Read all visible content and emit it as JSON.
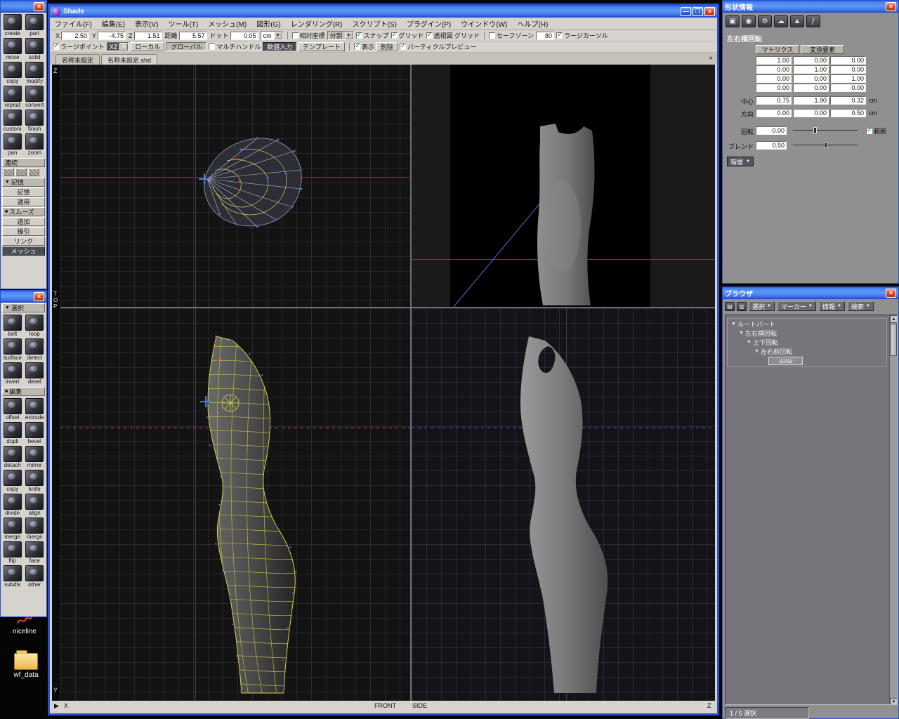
{
  "colors": {
    "titlebar_blue": "#2c5ce4",
    "wireframe_yellow": "#d8d544",
    "selection_red": "#e03030",
    "guide_pink": "#c2487a",
    "guide_blue": "#4a5ad0"
  },
  "palette1": {
    "tools": [
      "create",
      "part",
      "move",
      "solid",
      "copy",
      "modify",
      "repeat",
      "convert",
      "custom",
      "finish",
      "pan",
      "zoom"
    ],
    "header_continuous": "連続",
    "header_memory": "記憶",
    "btn_memory": "記憶",
    "btn_apply": "適用",
    "header_smooth": "スムーズ",
    "btn_add": "追加",
    "btn_saucer": "操引",
    "btn_link": "リンク",
    "btn_mesh": "メッシュ"
  },
  "palette2": {
    "header_select": "選択",
    "header_edit": "編集",
    "tools_select": [
      "belt",
      "loop",
      "surface",
      "detect",
      "invert",
      "desel"
    ],
    "tools_edit": [
      "offset",
      "extrude",
      "dupli",
      "bevel",
      "detach",
      "mirror",
      "copy",
      "knife",
      "divide",
      "align",
      "merge",
      "merge",
      "flip",
      "face",
      "subdiv",
      "other"
    ]
  },
  "desktop_icons": [
    {
      "label": "niceline"
    },
    {
      "label": "wf_data"
    }
  ],
  "main_window": {
    "title": "Shade",
    "menu": [
      "ファイル(F)",
      "編集(E)",
      "表示(V)",
      "ツール(T)",
      "メッシュ(M)",
      "図形(G)",
      "レンダリング(R)",
      "スクリプト(S)",
      "プラグイン(P)",
      "ウインドウ(W)",
      "ヘルプ(H)"
    ],
    "coord_fields": [
      {
        "label": "X",
        "value": "2.50"
      },
      {
        "label": "Y",
        "value": "-4.75"
      },
      {
        "label": "Z",
        "value": "1.51"
      },
      {
        "label": "距離",
        "value": "5.57"
      },
      {
        "label": "ドット",
        "value": "0.05"
      }
    ],
    "unit": "cm",
    "toolbar1": {
      "relative": {
        "label": "相対座標",
        "checked": false
      },
      "split": {
        "label": "分割"
      },
      "snap": {
        "label": "スナップ",
        "checked": true
      },
      "grid": {
        "label": "グリッド",
        "checked": true
      },
      "persp_grid": {
        "label": "透視図 グリッド",
        "checked": true
      },
      "safezone": {
        "label": "セーフゾーン",
        "checked": false
      },
      "safezone_value": "80",
      "large_cursor": {
        "label": "ラージカーソル",
        "checked": true
      }
    },
    "toolbar2": {
      "large_point": {
        "label": "ラージポイント",
        "checked": true
      },
      "plane": "XZ",
      "local": "ローカル",
      "global": "グローバル",
      "multi_handle": {
        "label": "マルチハンドル",
        "checked": false
      },
      "numeric": "数値入力",
      "template": "テンプレート",
      "show": {
        "label": "表示",
        "checked": true
      },
      "delete": "削除",
      "particle": {
        "label": "パーティクルプレビュー",
        "checked": true
      }
    },
    "tabs": [
      "名称未設定",
      "名称未設定.shd"
    ]
  },
  "viewport": {
    "axis_top": "Z",
    "view_top_letters": [
      "T",
      "O",
      "P"
    ],
    "axis_y": "Y",
    "axis_x": "X",
    "label_front": "FRONT",
    "label_side": "SIDE",
    "axis_z": "Z"
  },
  "shape_info": {
    "title": "形状情報",
    "object_label": "左右横回転",
    "tabs": [
      "マトリクス",
      "変換要素"
    ],
    "matrix": [
      "1.00",
      "0.00",
      "0.00",
      "0.00",
      "1.00",
      "0.00",
      "0.00",
      "0.00",
      "1.00",
      "0.00",
      "0.00",
      "0.00"
    ],
    "center": {
      "label": "中心",
      "values": [
        "0.75",
        "1.90",
        "0.32"
      ],
      "unit": "cm"
    },
    "direction": {
      "label": "方向",
      "values": [
        "0.00",
        "0.00",
        "0.50"
      ],
      "unit": "cm"
    },
    "rotation": {
      "label": "回転",
      "value": "0.00"
    },
    "range": {
      "label": "範囲",
      "checked": true
    },
    "blend": {
      "label": "ブレンド",
      "value": "0.50"
    },
    "hierarchy_label": "階層"
  },
  "browser": {
    "title": "ブラウザ",
    "toolbar": [
      "選択",
      "マーカー",
      "情報",
      "検索"
    ],
    "tree": [
      {
        "label": "ルートパート",
        "indent": 0,
        "arrow": true
      },
      {
        "label": "左右横回転",
        "indent": 1,
        "arrow": true
      },
      {
        "label": "上下回転",
        "indent": 2,
        "arrow": true
      },
      {
        "label": "左右前回転",
        "indent": 3,
        "arrow": true
      },
      {
        "label": "sotai",
        "indent": 4,
        "selected": true
      }
    ],
    "status": "1 / 5 選択"
  }
}
